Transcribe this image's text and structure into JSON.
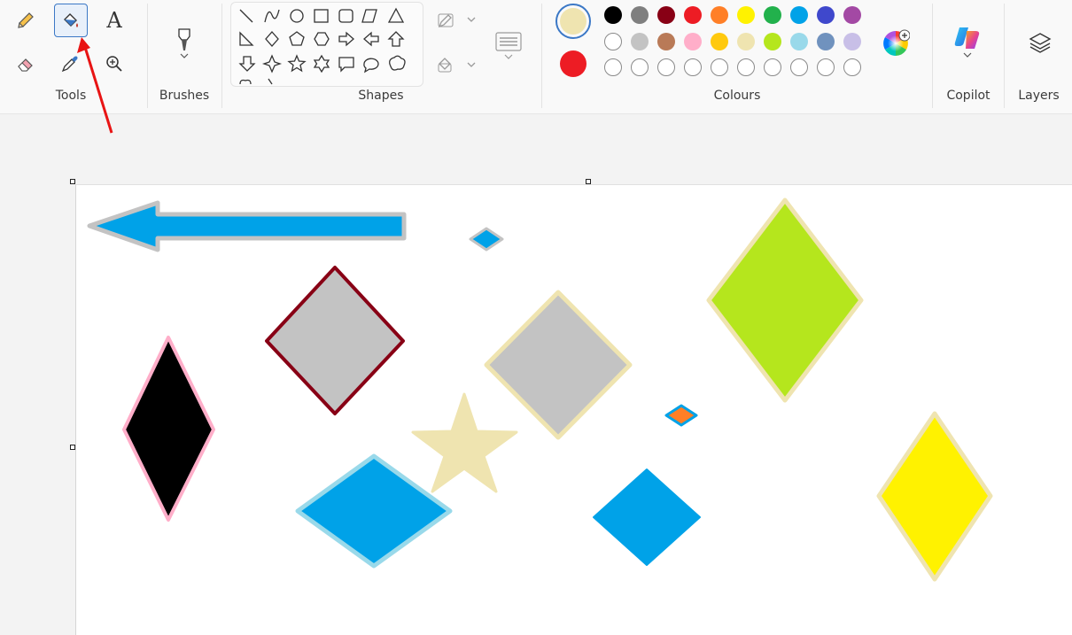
{
  "ribbon": {
    "groups": {
      "tools": "Tools",
      "brushes": "Brushes",
      "shapes": "Shapes",
      "colours": "Colours",
      "copilot": "Copilot",
      "layers": "Layers"
    },
    "tools": [
      {
        "name": "pencil",
        "selected": false
      },
      {
        "name": "fill",
        "selected": true
      },
      {
        "name": "text",
        "label": "A",
        "selected": false
      },
      {
        "name": "eraser",
        "selected": false
      },
      {
        "name": "color-picker",
        "selected": false
      },
      {
        "name": "magnifier",
        "selected": false
      }
    ]
  },
  "colours": {
    "colour1": "#efe4b0",
    "colour2": "#ed1c24",
    "palette_row1": [
      "#000000",
      "#7f7f7f",
      "#880015",
      "#ed1c24",
      "#ff7f27",
      "#fff200",
      "#22b14c",
      "#00a2e8",
      "#3f48cc",
      "#a349a4"
    ],
    "palette_row2": [
      "#ffffff",
      "#c3c3c3",
      "#b97a57",
      "#ffaec9",
      "#ffc90e",
      "#efe4b0",
      "#b5e61d",
      "#99d9ea",
      "#7092be",
      "#c8bfe7"
    ],
    "palette_row3_empty": 10
  },
  "canvas": {
    "background": "#ffffff",
    "shapes": [
      {
        "type": "arrow-left",
        "fill": "#00a2e8",
        "stroke": "#c3c3c3"
      },
      {
        "type": "diamond",
        "fill": "#00a2e8",
        "stroke": "#c3c3c3"
      },
      {
        "type": "diamond",
        "fill": "#c3c3c3",
        "stroke": "#880015"
      },
      {
        "type": "diamond",
        "fill": "#c3c3c3",
        "stroke": "#efe4b0"
      },
      {
        "type": "diamond",
        "fill": "#b5e61d",
        "stroke": "#efe4b0"
      },
      {
        "type": "diamond",
        "fill": "#000000",
        "stroke": "#ffaec9"
      },
      {
        "type": "star",
        "fill": "#efe4b0",
        "stroke": "#efe4b0"
      },
      {
        "type": "diamond",
        "fill": "#ff7f27",
        "stroke": "#00a2e8"
      },
      {
        "type": "diamond",
        "fill": "#00a2e8",
        "stroke": "#99d9ea"
      },
      {
        "type": "diamond",
        "fill": "#00a2e8",
        "stroke": "#00a2e8"
      },
      {
        "type": "diamond",
        "fill": "#fff200",
        "stroke": "#efe4b0"
      }
    ]
  },
  "annotation": {
    "color": "#e81414"
  }
}
